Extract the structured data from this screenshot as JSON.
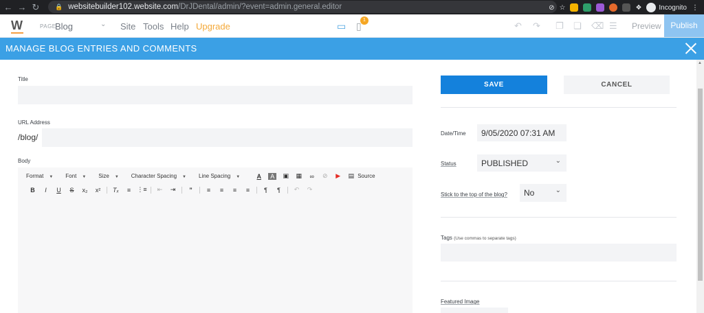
{
  "browser": {
    "url_host": "websitebuilder102.website.com",
    "url_path": "/DrJDental/admin/?event=admin.general.editor",
    "profile_label": "Incognito"
  },
  "topbar": {
    "page_prefix": "PAGE",
    "page_name": "Blog",
    "menu": [
      "Site",
      "Tools",
      "Help",
      "Upgrade"
    ],
    "badge_count": "1",
    "preview_label": "Preview",
    "publish_label": "Publish"
  },
  "modal": {
    "title": "MANAGE BLOG ENTRIES AND COMMENTS"
  },
  "form": {
    "title_label": "Title",
    "title_value": "",
    "url_label": "URL Address",
    "url_prefix": "/blog/",
    "url_value": "",
    "body_label": "Body",
    "toolbar": {
      "format": "Format",
      "font": "Font",
      "size": "Size",
      "char_spacing": "Character Spacing",
      "line_spacing": "Line Spacing",
      "source": "Source"
    }
  },
  "sidebar": {
    "save_label": "SAVE",
    "cancel_label": "CANCEL",
    "datetime_label": "Date/Time",
    "datetime_value": "9/05/2020 07:31 AM",
    "status_label": "Status",
    "status_value": "PUBLISHED",
    "stick_label": "Stick to the top of the blog?",
    "stick_value": "No",
    "tags_label": "Tags",
    "tags_hint": "(Use commas to separate tags)",
    "tags_value": "",
    "featured_label": "Featured Image"
  },
  "colors": {
    "accent": "#3ba0e5",
    "save_button": "#1481dc",
    "upgrade": "#f4a838",
    "publish": "#8ec4f1"
  }
}
